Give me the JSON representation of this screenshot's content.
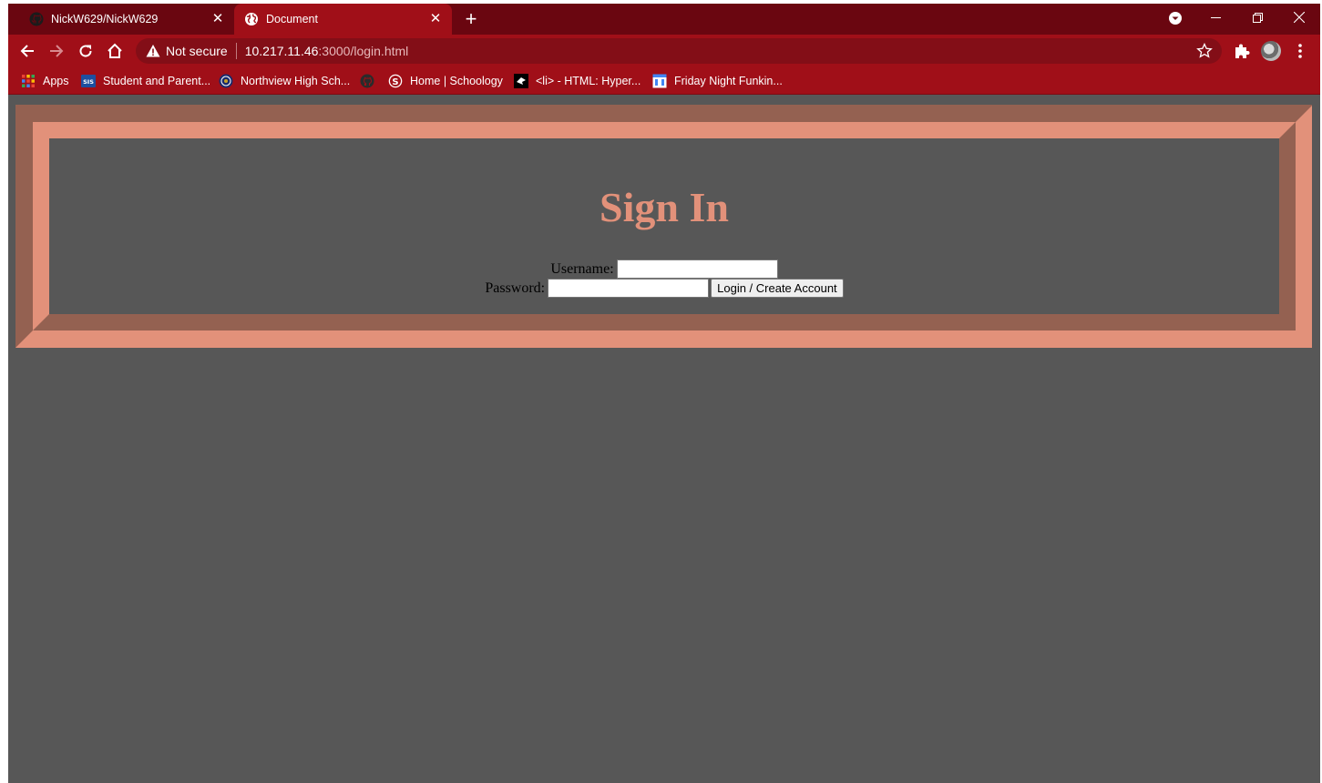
{
  "browser": {
    "tabs": [
      {
        "title": "NickW629/NickW629",
        "active": false,
        "icon": "github-icon"
      },
      {
        "title": "Document",
        "active": true,
        "icon": "globe-icon"
      }
    ],
    "new_tab_label": "+",
    "close_symbol": "✕",
    "security_label": "Not secure",
    "url_host": "10.217.11.46",
    "url_rest": ":3000/login.html",
    "bookmarks": [
      {
        "label": "Apps",
        "icon": "apps-grid-icon"
      },
      {
        "label": "Student and Parent...",
        "icon": "sis-icon"
      },
      {
        "label": "Northview High Sch...",
        "icon": "school-icon"
      },
      {
        "label": "",
        "icon": "github-icon"
      },
      {
        "label": "Home | Schoology",
        "icon": "schoology-icon"
      },
      {
        "label": "<li> - HTML: Hyper...",
        "icon": "mdn-icon"
      },
      {
        "label": "Friday Night Funkin...",
        "icon": "calendar-icon"
      }
    ],
    "colors": {
      "tabstrip": "#6a0610",
      "toolbar": "#a00f18",
      "omnibox": "#830e17"
    }
  },
  "page": {
    "title": "Sign In",
    "username_label": "Username:",
    "username_value": "",
    "password_label": "Password:",
    "password_value": "",
    "submit_label": "Login / Create Account",
    "colors": {
      "background": "#575757",
      "accent": "#e2917a",
      "accent_dark": "#946151"
    }
  }
}
